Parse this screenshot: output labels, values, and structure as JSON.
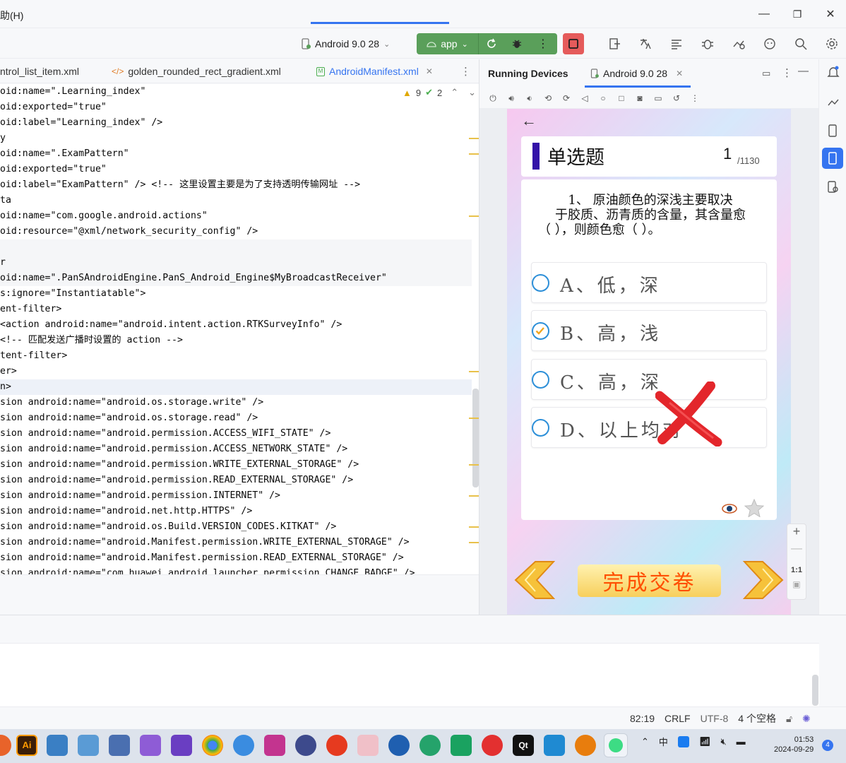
{
  "window": {
    "menu_help": "助(H)",
    "min": "—",
    "max": "❐",
    "close": "✕"
  },
  "toolbar": {
    "device": "Android 9.0 28",
    "run_config": "app"
  },
  "editor_tabs": [
    {
      "label": "ntrol_list_item.xml"
    },
    {
      "label": "golden_rounded_rect_gradient.xml"
    },
    {
      "label": "AndroidManifest.xml"
    }
  ],
  "inspection": {
    "warnings": "9",
    "ok": "2"
  },
  "code_lines": [
    "oid:name=\".Learning_index\"",
    "oid:exported=\"true\"",
    "oid:label=\"Learning_index\" />",
    "y",
    "oid:name=\".ExamPattern\"",
    "oid:exported=\"true\"",
    "oid:label=\"ExamPattern\" /> <!-- 这里设置主要是为了支持透明传输网址 -->",
    "ta",
    "oid:name=\"com.google.android.actions\"",
    "oid:resource=\"@xml/network_security_config\" />",
    "",
    "r",
    "oid:name=\".PanSAndroidEngine.PanS_Android_Engine$MyBroadcastReceiver\"",
    "s:ignore=\"Instantiatable\">",
    "ent-filter>",
    "<action android:name=\"android.intent.action.RTKSurveyInfo\" />",
    "<!-- 匹配发送广播时设置的 action -->",
    "tent-filter>",
    "er>",
    "n>",
    "sion android:name=\"android.os.storage.write\" />",
    "sion android:name=\"android.os.storage.read\" />",
    "sion android:name=\"android.permission.ACCESS_WIFI_STATE\" />",
    "sion android:name=\"android.permission.ACCESS_NETWORK_STATE\" />",
    "sion android:name=\"android.permission.WRITE_EXTERNAL_STORAGE\" />",
    "sion android:name=\"android.permission.READ_EXTERNAL_STORAGE\" />",
    "sion android:name=\"android.permission.INTERNET\" />",
    "sion android:name=\"android.net.http.HTTPS\" />",
    "sion android:name=\"android.os.Build.VERSION_CODES.KITKAT\" />",
    "sion android:name=\"android.Manifest.permission.WRITE_EXTERNAL_STORAGE\" />",
    "sion android:name=\"android.Manifest.permission.READ_EXTERNAL_STORAGE\" />",
    "sion android:name=\"com.huawei.android.launcher.permission.CHANGE_BADGE\" />"
  ],
  "running_devices": {
    "title": "Running Devices",
    "tab": "Android 9.0 28"
  },
  "app": {
    "question_type": "单选题",
    "current": "1",
    "total": "/1130",
    "question_line1": "1、 原油颜色的深浅主要取决",
    "question_line2": "于胶质、沥青质的含量，其含量愈",
    "question_line3": "（    ），则颜色愈（    ）。",
    "options": [
      {
        "label": "A、低，深",
        "selected": false
      },
      {
        "label": "B、高，浅",
        "selected": true
      },
      {
        "label": "C、高，深",
        "selected": false
      },
      {
        "label": "D、以上均对",
        "selected": false
      }
    ],
    "submit_label": "完成交卷"
  },
  "zoom": {
    "ratio": "1:1"
  },
  "status": {
    "position": "82:19",
    "line_sep": "CRLF",
    "encoding": "UTF-8",
    "indent": "4 个空格"
  },
  "tray": {
    "ime": "中",
    "time": "01:53",
    "date": "2024-09-29",
    "notifications": "4"
  },
  "colors": {
    "accent": "#3574f0",
    "run_green": "#5a9f5a",
    "stop_red": "#e55b5b",
    "option_blue": "#2d8fd8",
    "check_orange": "#f2a61f",
    "submit_text": "#ff4f00"
  }
}
